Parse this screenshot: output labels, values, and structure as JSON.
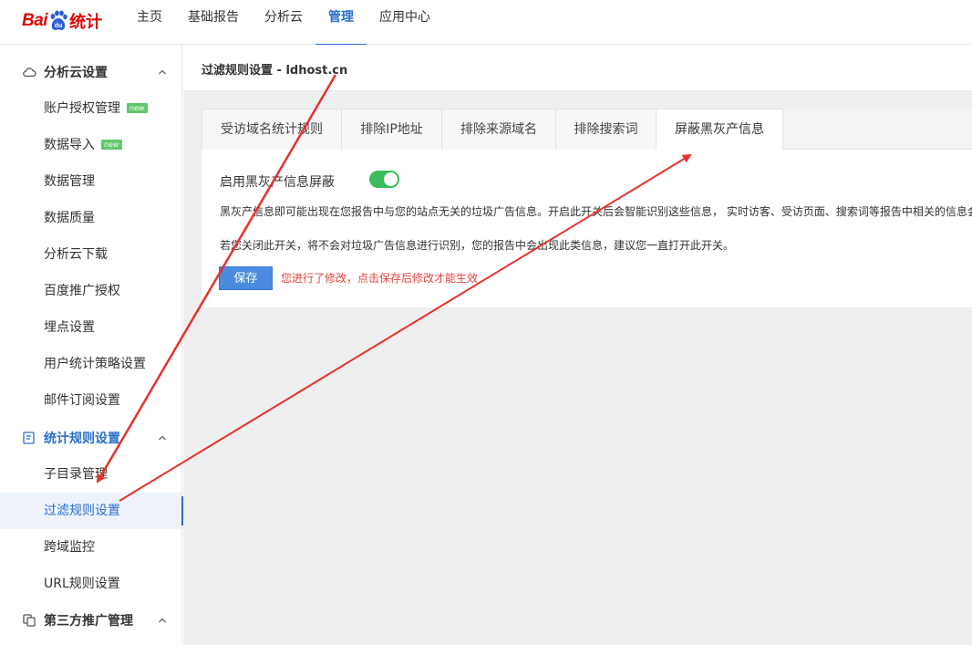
{
  "logo": {
    "bai": "Bai",
    "tongji": "统计"
  },
  "nav": [
    "主页",
    "基础报告",
    "分析云",
    "管理",
    "应用中心"
  ],
  "nav_active": "管理",
  "sidebar": {
    "group1": {
      "label": "分析云设置",
      "icon": "cloud-icon",
      "items": [
        {
          "label": "账户授权管理",
          "badge": "new"
        },
        {
          "label": "数据导入",
          "badge": "new"
        },
        {
          "label": "数据管理"
        },
        {
          "label": "数据质量"
        },
        {
          "label": "分析云下载"
        },
        {
          "label": "百度推广授权"
        },
        {
          "label": "埋点设置"
        },
        {
          "label": "用户统计策略设置"
        },
        {
          "label": "邮件订阅设置"
        }
      ]
    },
    "group2": {
      "label": "统计规则设置",
      "icon": "edit-list-icon",
      "items": [
        {
          "label": "子目录管理"
        },
        {
          "label": "过滤规则设置",
          "active": true
        },
        {
          "label": "跨域监控"
        },
        {
          "label": "URL规则设置"
        }
      ]
    },
    "group3": {
      "label": "第三方推广管理",
      "icon": "copy-icon"
    }
  },
  "page_title": "过滤规则设置 - ldhost.cn",
  "tabs": [
    "受访域名统计规则",
    "排除IP地址",
    "排除来源域名",
    "排除搜索词",
    "屏蔽黑灰产信息"
  ],
  "active_tab": "屏蔽黑灰产信息",
  "toggle": {
    "label": "启用黑灰产信息屏蔽",
    "on": true
  },
  "desc1": "黑灰产信息即可能出现在您报告中与您的站点无关的垃圾广告信息。开启此开关后会智能识别这些信息， 实时访客、受访页面、搜索词等报告中相关的信息会",
  "desc2": "若您关闭此开关，将不会对垃圾广告信息进行识别，您的报告中会出现此类信息，建议您一直打开此开关。",
  "save_label": "保存",
  "warning": "您进行了修改，点击保存后修改才能生效",
  "colors": {
    "brand_red": "#e10602",
    "accent_blue": "#2a6fc9",
    "toggle_green": "#3cbb5a",
    "arrow_red": "#e8322d"
  }
}
